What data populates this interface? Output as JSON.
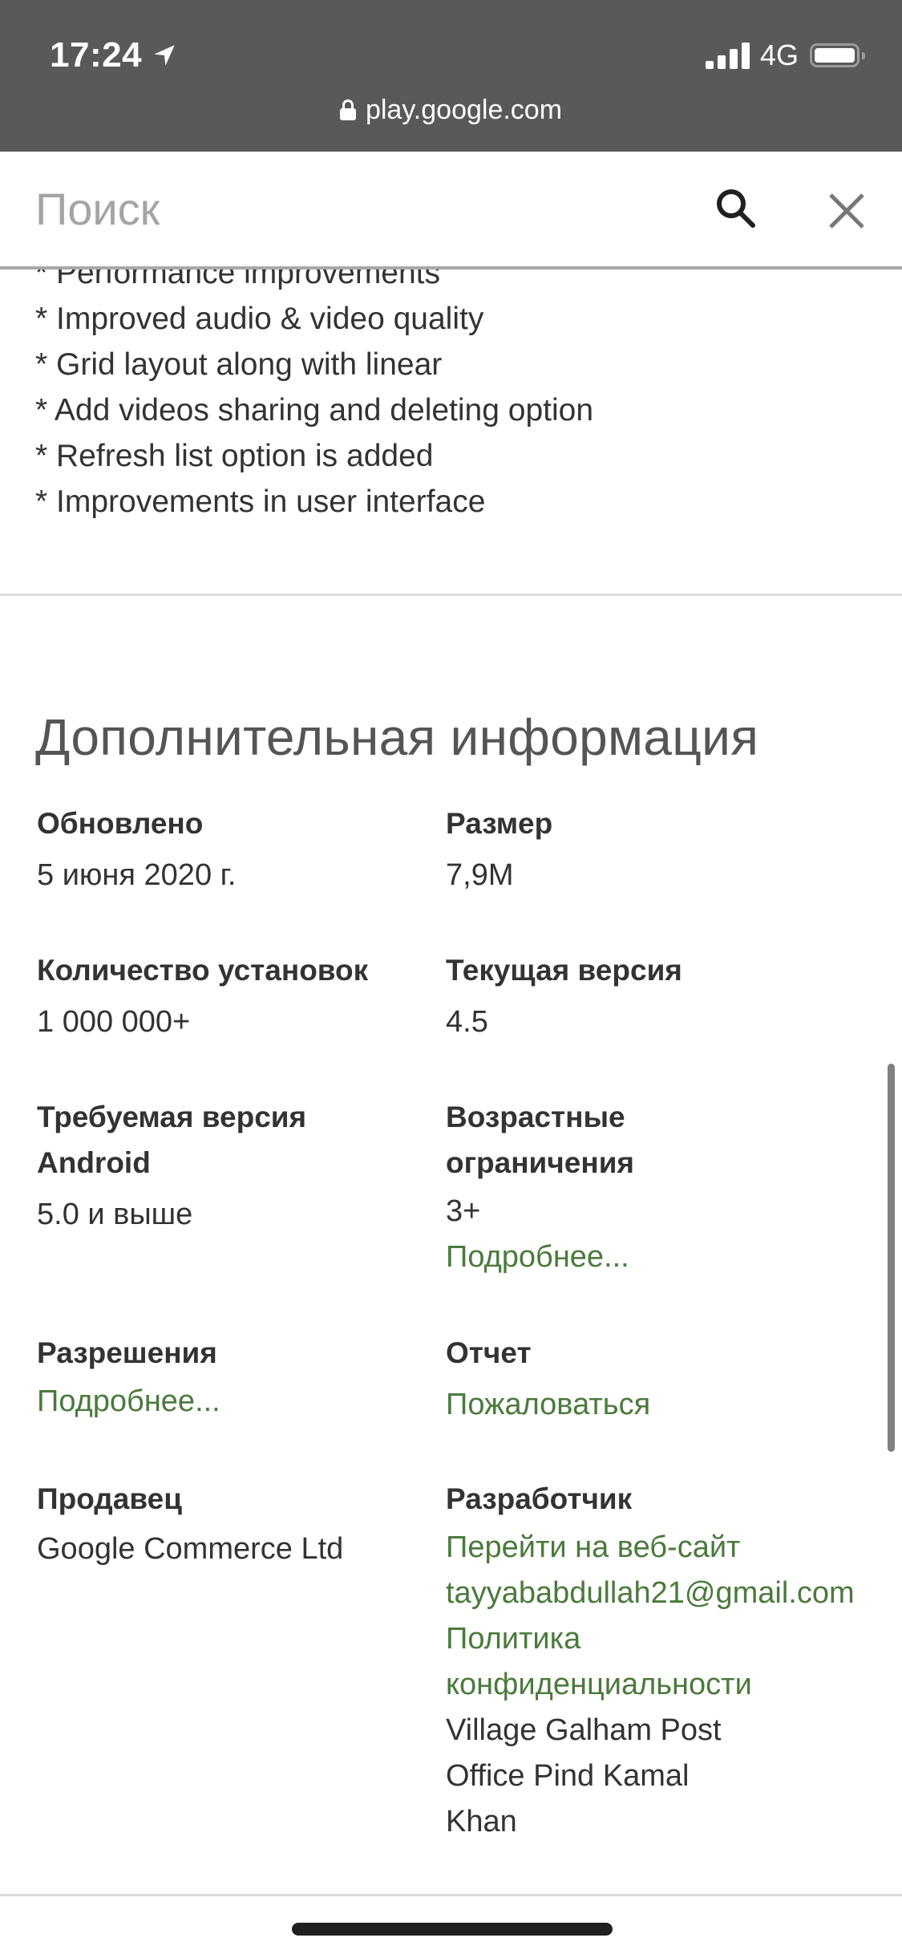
{
  "status_bar": {
    "time": "17:24",
    "location_icon": "location-arrow-icon",
    "signal_icon": "cellular-signal-icon",
    "network": "4G",
    "battery_icon": "battery-full-icon"
  },
  "browser": {
    "lock_icon": "lock-icon",
    "url": "play.google.com"
  },
  "search": {
    "placeholder": "Поиск",
    "value": "",
    "search_icon": "search-icon",
    "close_icon": "close-icon"
  },
  "whats_new": {
    "items": [
      "* Performance improvements",
      "* Improved audio & video quality",
      "* Grid layout along with linear",
      "* Add videos sharing and deleting option",
      "* Refresh list option is added",
      "* Improvements in user interface"
    ]
  },
  "additional_info": {
    "title": "Дополнительная информация",
    "updated": {
      "label": "Обновлено",
      "value": "5 июня 2020 г."
    },
    "size": {
      "label": "Размер",
      "value": "7,9M"
    },
    "installs": {
      "label": "Количество установок",
      "value": "1 000 000+"
    },
    "current_version": {
      "label": "Текущая версия",
      "value": "4.5"
    },
    "requires_android": {
      "label": "Требуемая версия Android",
      "value": "5.0 и выше"
    },
    "content_rating": {
      "label": "Возрастные ограничения",
      "value": "3+",
      "link": "Подробнее..."
    },
    "permissions": {
      "label": "Разрешения",
      "link": "Подробнее..."
    },
    "report": {
      "label": "Отчет",
      "link": "Пожаловаться"
    },
    "offered_by": {
      "label": "Продавец",
      "value": "Google Commerce Ltd"
    },
    "developer": {
      "label": "Разработчик",
      "website_link": "Перейти на веб-сайт",
      "email_link": "tayyababdullah21@gmail.com",
      "privacy_link": "Политика конфиденциальности",
      "address_line1": "Village Galham Post",
      "address_line2": "Office Pind Kamal Khan"
    }
  },
  "colors": {
    "status_bar_bg": "#595959",
    "link_green": "#4b7a3c",
    "text": "#333333",
    "placeholder": "#a4a4a4"
  }
}
